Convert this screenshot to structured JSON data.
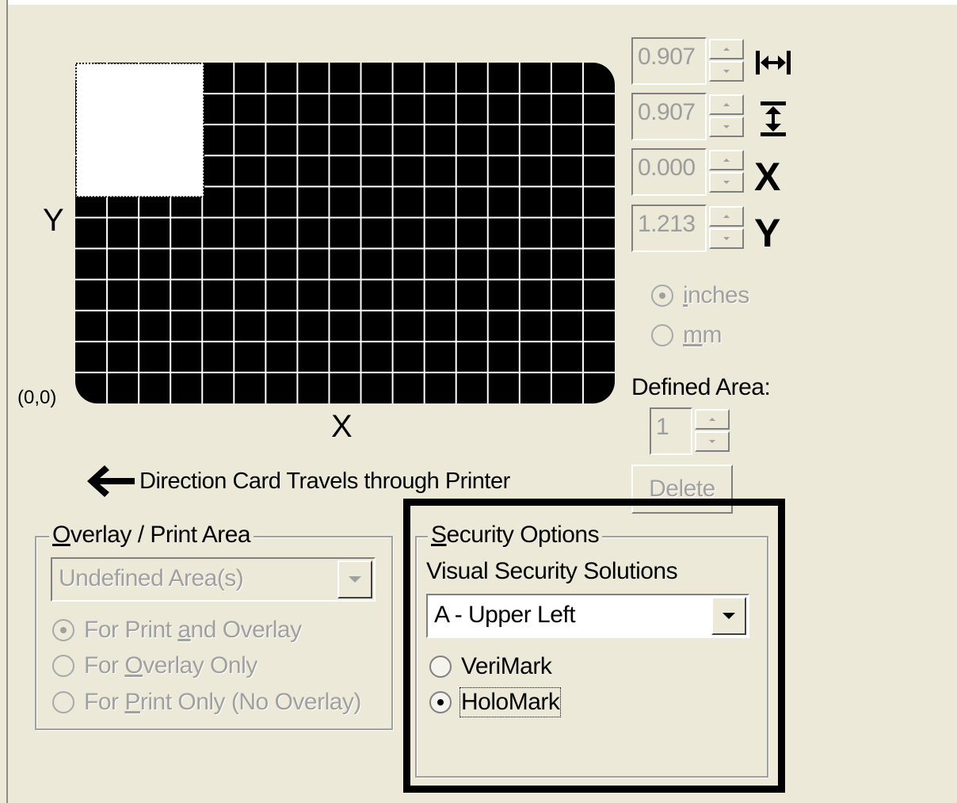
{
  "card": {
    "y_axis_label": "Y",
    "x_axis_label": "X",
    "origin_label": "(0,0)",
    "direction_text": "Direction Card Travels through Printer",
    "grid_columns": 17,
    "grid_rows": 11,
    "defined_area_columns": 4,
    "defined_area_rows": 4
  },
  "dimensions": {
    "width": {
      "value": "0.907",
      "icon": "width-arrows-icon"
    },
    "height": {
      "value": "0.907",
      "icon": "height-arrows-icon"
    },
    "x": {
      "value": "0.000",
      "icon_label": "X"
    },
    "y": {
      "value": "1.213",
      "icon_label": "Y"
    }
  },
  "units": {
    "inches_label": "inches",
    "mm_label": "mm",
    "selected": "inches"
  },
  "defined_area": {
    "label": "Defined Area:",
    "value": "1",
    "delete_label": "Delete"
  },
  "overlay_print_area": {
    "title": "Overlay / Print Area",
    "combo_value": "Undefined Area(s)",
    "options": [
      {
        "label": "For Print and Overlay",
        "selected": true
      },
      {
        "label": "For Overlay Only",
        "selected": false
      },
      {
        "label": "For Print Only (No Overlay)",
        "selected": false
      }
    ]
  },
  "security_options": {
    "title": "Security Options",
    "subtitle": "Visual Security Solutions",
    "combo_value": "A - Upper Left",
    "options": [
      {
        "label": "VeriMark",
        "selected": false
      },
      {
        "label": "HoloMark",
        "selected": true
      }
    ]
  },
  "colors": {
    "background": "#ece9d8",
    "card_fill": "#000000",
    "grid_line": "#ffffff",
    "disabled_text": "#a0a0a0"
  }
}
